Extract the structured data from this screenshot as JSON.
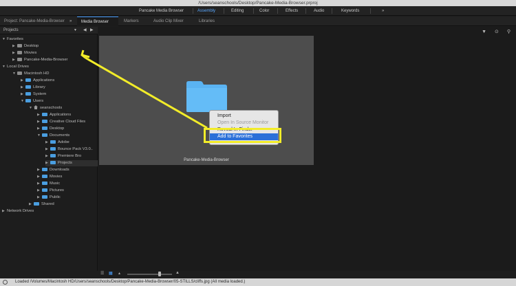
{
  "window": {
    "title": "/Users/seanschools/Desktop/Pancake-Media-Browser.prproj"
  },
  "workspaces": {
    "items": [
      "Pancake Media Browser",
      "Assembly",
      "Editing",
      "Color",
      "Effects",
      "Audio",
      "Keywords"
    ],
    "active": "Assembly",
    "more": "»"
  },
  "panel_tabs": {
    "project": "Project: Pancake-Media-Browser",
    "media_browser": "Media Browser",
    "markers": "Markers",
    "audio_clip_mixer": "Audio Clip Mixer",
    "libraries": "Libraries",
    "more": "»"
  },
  "left_header": {
    "title": "Projects",
    "dropdown": "▼",
    "back": "◀",
    "forward": "▶"
  },
  "tree": {
    "favorites": "Favorites",
    "desktop": "Desktop",
    "movies": "Movies",
    "pancake": "Pancake-Media-Browser",
    "local_drives": "Local Drives",
    "macintosh_hd": "Macintosh HD",
    "applications": "Applications",
    "library": "Library",
    "system": "System",
    "users": "Users",
    "seanschools": "seanschools",
    "user_applications": "Applications",
    "creative_cloud_files": "Creative Cloud Files",
    "user_desktop": "Desktop",
    "documents": "Documents",
    "adobe": "Adobe",
    "bounce_pack": "Bounce Pack V3.0..",
    "premiere_bro": "Premiere Bro",
    "projects": "Projects",
    "downloads": "Downloads",
    "user_movies": "Movies",
    "music": "Music",
    "pictures": "Pictures",
    "public": "Public",
    "shared": "Shared",
    "network_drives": "Network Drives"
  },
  "browser": {
    "thumbnail_label": "Pancake-Media-Browser",
    "toolbar_icons": [
      "filter-icon",
      "display-icon",
      "search-icon"
    ]
  },
  "context_menu": {
    "import": "Import",
    "open_in_source_monitor": "Open In Source Monitor",
    "reveal_in_finder": "Reveal In Finder",
    "add_to_favorites": "Add to Favorites"
  },
  "status": {
    "text": "Loaded /Volumes/Macintosh HD/Users/seanschools/Desktop/Pancake-Media-Browser/05-STILLS/cliffs.jpg (All media loaded.)"
  },
  "colors": {
    "accent": "#4aa0ff",
    "annotation": "#f2ec29",
    "menu_highlight": "#2b70d8",
    "folder": "#4a9ee0"
  },
  "zoom_slider": {
    "value": 0.7
  }
}
